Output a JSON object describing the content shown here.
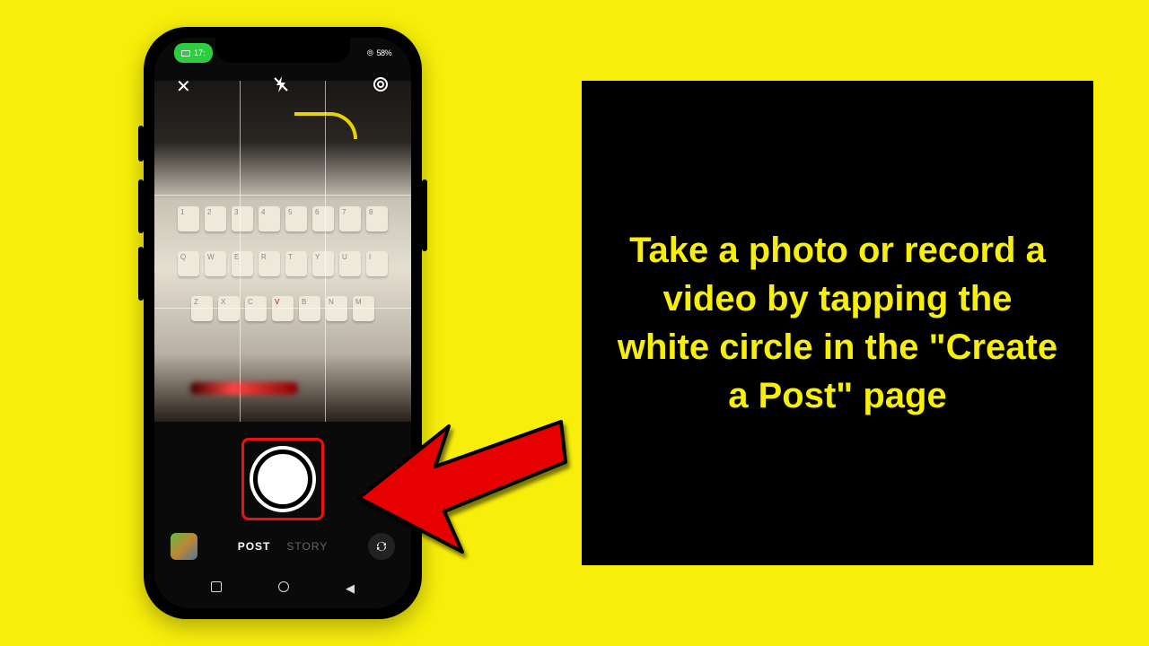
{
  "status_bar": {
    "time": "17:",
    "battery": "58%",
    "signal_glyph": "⦾"
  },
  "top_controls": {
    "close": "✕",
    "flash_off": "✕",
    "settings": "⚙"
  },
  "shutter": {
    "label": "shutter"
  },
  "modes": {
    "post": "POST",
    "story": "STORY"
  },
  "nav": {
    "recent": "■",
    "home": "◉",
    "back": "◀"
  },
  "instruction": {
    "text": "Take a photo or record a video by tapping the white circle in the \"Create a Post\" page"
  },
  "keyboard": {
    "row1": [
      "1",
      "2",
      "3",
      "4",
      "5",
      "6",
      "7",
      "8"
    ],
    "row2": [
      "Q",
      "W",
      "E",
      "R",
      "T",
      "Y",
      "U",
      "I"
    ],
    "row3": [
      "Z",
      "X",
      "C",
      "V",
      "B",
      "N",
      "M"
    ]
  }
}
